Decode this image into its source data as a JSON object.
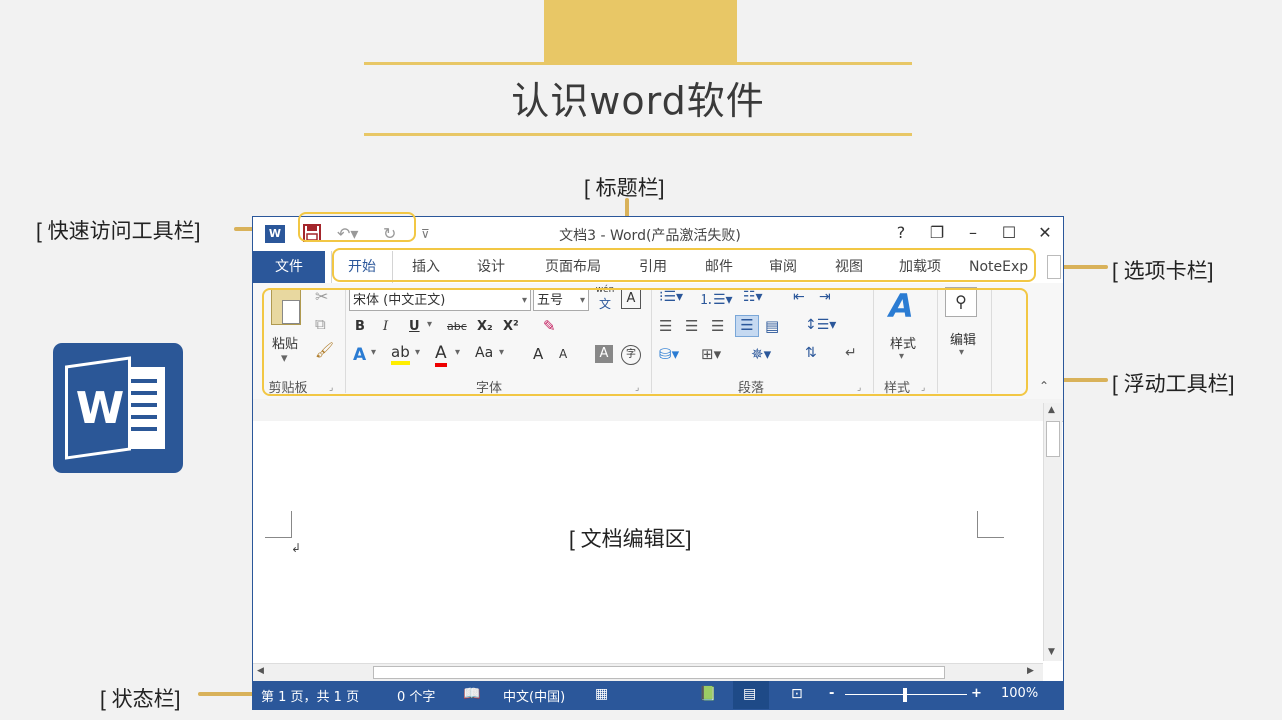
{
  "slide": {
    "title": "认识word软件",
    "callouts": {
      "title_bar": "[ 标题栏]",
      "quick_access": "[ 快速访问工具栏]",
      "tabs": "[ 选项卡栏]",
      "floating_toolbar": "[ 浮动工具栏]",
      "doc_area": "[ 文档编辑区]",
      "status_bar": "[ 状态栏]"
    },
    "colors": {
      "gold": "#e8c766",
      "word_blue": "#2b579a"
    }
  },
  "window": {
    "title": "文档3 - Word(产品激活失败)",
    "app_icon": "W",
    "title_buttons": [
      "?",
      "❐",
      "–",
      "☐",
      "✕"
    ]
  },
  "tabs": {
    "file": "文件",
    "items": [
      "开始",
      "插入",
      "设计",
      "页面布局",
      "引用",
      "邮件",
      "审阅",
      "视图",
      "加载项",
      "NoteExp"
    ],
    "active": "开始"
  },
  "ribbon": {
    "clipboard": {
      "label": "剪贴板",
      "paste": "粘贴"
    },
    "font": {
      "label": "字体",
      "font_name": "宋体 (中文正文)",
      "font_size": "五号",
      "pinyin": "wén",
      "pinyin_char": "文",
      "bold": "B",
      "italic": "I",
      "underline": "U",
      "strike": "abc",
      "sub": "X₂",
      "sup": "X²",
      "case": "Aa",
      "grow": "A",
      "shrink": "A",
      "enclose": "字",
      "border_char": "A"
    },
    "paragraph": {
      "label": "段落"
    },
    "styles": {
      "label": "样式",
      "button": "样式"
    },
    "editing": {
      "button": "编辑"
    }
  },
  "status": {
    "page": "第 1 页，共 1 页",
    "words": "0 个字",
    "language": "中文(中国)",
    "zoom": "100%",
    "zoom_minus": "-",
    "zoom_plus": "+"
  }
}
